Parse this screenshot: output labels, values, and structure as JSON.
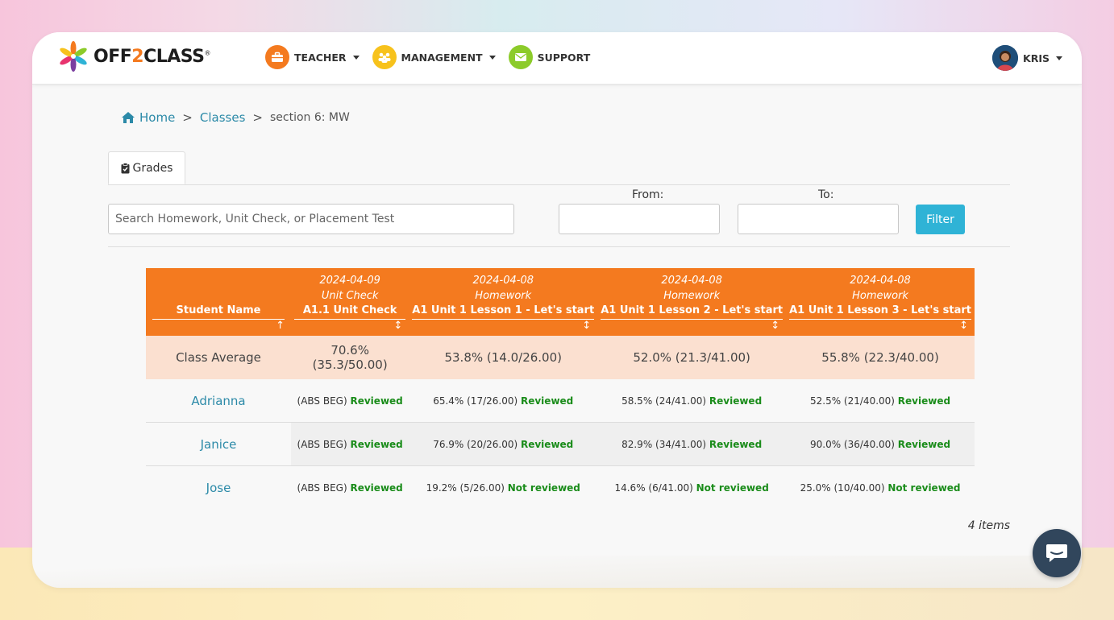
{
  "brand": {
    "name_part1": "OFF",
    "name_digit": "2",
    "name_part2": "CLASS",
    "registered": "®"
  },
  "nav": {
    "items": [
      {
        "label": "TEACHER",
        "icon": "briefcase-icon",
        "color": "#f47a1f",
        "has_dropdown": true
      },
      {
        "label": "MANAGEMENT",
        "icon": "people-icon",
        "color": "#f7c21c",
        "has_dropdown": true
      },
      {
        "label": "SUPPORT",
        "icon": "envelope-icon",
        "color": "#8ccb2a",
        "has_dropdown": false
      }
    ],
    "user": {
      "name": "KRIS",
      "has_dropdown": true
    }
  },
  "breadcrumb": {
    "home": "Home",
    "sep1": ">",
    "classes": "Classes",
    "sep2": ">",
    "current": "section 6: MW"
  },
  "tabs": {
    "grades": "Grades"
  },
  "filters": {
    "search_placeholder": "Search Homework, Unit Check, or Placement Test",
    "search_value": "",
    "from_label": "From:",
    "to_label": "To:",
    "from_value": "",
    "to_value": "",
    "filter_button": "Filter"
  },
  "table": {
    "columns": [
      {
        "date": "",
        "type": "",
        "title": "Student Name",
        "sort": "↑"
      },
      {
        "date": "2024-04-09",
        "type": "Unit Check",
        "title": "A1.1 Unit Check",
        "sort": "↕"
      },
      {
        "date": "2024-04-08",
        "type": "Homework",
        "title": "A1 Unit 1 Lesson 1 - Let's start",
        "sort": "↕"
      },
      {
        "date": "2024-04-08",
        "type": "Homework",
        "title": "A1 Unit 1 Lesson 2 - Let's start",
        "sort": "↕"
      },
      {
        "date": "2024-04-08",
        "type": "Homework",
        "title": "A1 Unit 1 Lesson 3 - Let's start",
        "sort": "↕"
      }
    ],
    "average": {
      "label": "Class Average",
      "values": [
        "70.6% (35.3/50.00)",
        "53.8% (14.0/26.00)",
        "52.0% (21.3/41.00)",
        "55.8% (22.3/40.00)"
      ]
    },
    "rows": [
      {
        "name": "Adrianna",
        "cells": [
          {
            "score": "(ABS BEG)",
            "status": "Reviewed"
          },
          {
            "score": "65.4% (17/26.00)",
            "status": "Reviewed"
          },
          {
            "score": "58.5% (24/41.00)",
            "status": "Reviewed"
          },
          {
            "score": "52.5% (21/40.00)",
            "status": "Reviewed"
          }
        ]
      },
      {
        "name": "Janice",
        "cells": [
          {
            "score": "(ABS BEG)",
            "status": "Reviewed"
          },
          {
            "score": "76.9% (20/26.00)",
            "status": "Reviewed"
          },
          {
            "score": "82.9% (34/41.00)",
            "status": "Reviewed"
          },
          {
            "score": "90.0% (36/40.00)",
            "status": "Reviewed"
          }
        ]
      },
      {
        "name": "Jose",
        "cells": [
          {
            "score": "(ABS BEG)",
            "status": "Reviewed"
          },
          {
            "score": "19.2% (5/26.00)",
            "status": "Not reviewed"
          },
          {
            "score": "14.6% (6/41.00)",
            "status": "Not reviewed"
          },
          {
            "score": "25.0% (10/40.00)",
            "status": "Not reviewed"
          }
        ]
      }
    ],
    "item_count": "4 items"
  },
  "colors": {
    "header_orange": "#f47a1f",
    "average_row": "#fbe0d0",
    "link_teal": "#2c8aa8",
    "status_green": "#1a8c1a",
    "filter_button": "#2fb3d6",
    "chat_button": "#31465c"
  },
  "chat": {
    "icon": "chat-bubble-icon"
  }
}
